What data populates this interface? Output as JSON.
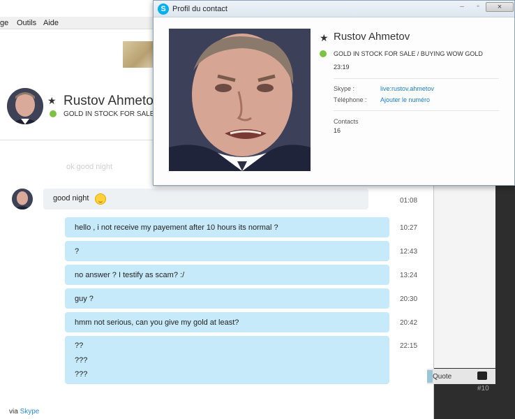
{
  "menu": {
    "view": "ge",
    "tools": "Outils",
    "help": "Aide"
  },
  "header": {
    "name": "Rustov Ahmetov",
    "mood": "GOLD IN STOCK FOR SALE /"
  },
  "conversation": {
    "ghost": "ok good night",
    "received": {
      "text": "good night",
      "time": "01:08"
    },
    "sent": [
      {
        "text": "hello  , i not receive my payement after 10 hours its normal ?",
        "time": "10:27"
      },
      {
        "text": "?",
        "time": "12:43"
      },
      {
        "text": "no answer ? I testify as scam? :/",
        "time": "13:24"
      },
      {
        "text": "guy ?",
        "time": "20:30"
      },
      {
        "text": "hmm not serious, can you give my gold at least?",
        "time": "20:42"
      },
      {
        "lines": [
          "??",
          "???",
          "???"
        ],
        "time": "22:15"
      }
    ],
    "via_prefix": "via",
    "via_brand": "Skype"
  },
  "side": {
    "quote_label": "Quote",
    "post_number": "#10"
  },
  "profile": {
    "window_title": "Profil du contact",
    "name": "Rustov Ahmetov",
    "mood": "GOLD IN STOCK FOR SALE / BUYING WOW GOLD",
    "local_time": "23:19",
    "skype_label": "Skype :",
    "skype_value": "live:rustov.ahmetov",
    "phone_label": "Téléphone :",
    "phone_value": "Ajouter le numéro",
    "contacts_label": "Contacts",
    "contacts_count": "16",
    "close_label": "×",
    "logo_glyph": "S"
  },
  "colors": {
    "online": "#7cc243",
    "sent_bubble": "#c6eaf9",
    "received_bubble": "#edf1f4",
    "link": "#1a7fc8",
    "skype_blue": "#00aff0"
  }
}
